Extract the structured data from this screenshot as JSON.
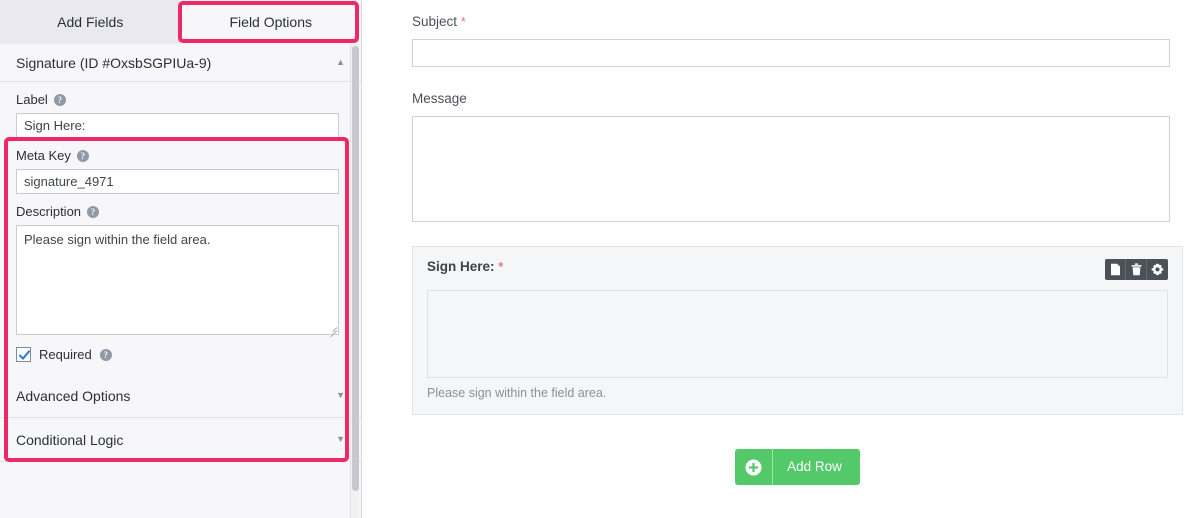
{
  "sidebar": {
    "tabs": [
      {
        "label": "Add Fields",
        "active": false
      },
      {
        "label": "Field Options",
        "active": true
      }
    ],
    "field_panel": {
      "title": "Signature (ID #OxsbSGPIUa-9)",
      "collapse_icon": "chevron-up-icon",
      "options": {
        "label_field": {
          "label": "Label",
          "help_icon": "help-icon",
          "value": "Sign Here:"
        },
        "meta_key_field": {
          "label": "Meta Key",
          "help_icon": "help-icon",
          "value": "signature_4971"
        },
        "description_field": {
          "label": "Description",
          "help_icon": "help-icon",
          "value": "Please sign within the field area."
        },
        "required_checkbox": {
          "label": "Required",
          "help_icon": "help-icon",
          "checked": true
        }
      }
    },
    "collapsed_sections": [
      {
        "label": "Advanced Options",
        "icon": "chevron-down-icon"
      },
      {
        "label": "Conditional Logic",
        "icon": "chevron-down-icon"
      }
    ]
  },
  "preview": {
    "subject": {
      "label": "Subject",
      "required_marker": "*",
      "value": "",
      "placeholder": ""
    },
    "message": {
      "label": "Message",
      "value": "",
      "placeholder": ""
    },
    "signature": {
      "label": "Sign Here:",
      "required_marker": "*",
      "description": "Please sign within the field area.",
      "tools": [
        {
          "name": "page-icon",
          "title": "Page"
        },
        {
          "name": "trash-icon",
          "title": "Delete"
        },
        {
          "name": "gear-icon",
          "title": "Settings"
        }
      ]
    },
    "add_row_button": {
      "label": "Add Row",
      "icon": "plus-circle-icon"
    }
  },
  "highlights": {
    "accent_color": "#ed2a64",
    "targets": [
      "field-options-tab",
      "field-options-block"
    ]
  },
  "colors": {
    "accent_pink": "#ed2a64",
    "button_green": "#53c96a",
    "checkbox_blue": "#2f80d4",
    "required_star": "#e27c7c",
    "sidebar_bg": "#f7f7f9",
    "tab_inactive_bg": "#e9e9ef",
    "signature_panel_bg": "#f5f6f8",
    "tool_bar_bg": "#4b5158"
  }
}
